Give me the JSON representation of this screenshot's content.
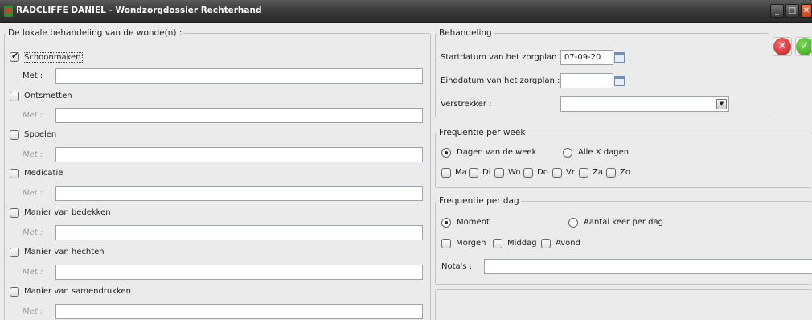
{
  "window": {
    "title": "RADCLIFFE DANIEL - Wondzorgdossier Rechterhand"
  },
  "left": {
    "legend": "De lokale behandeling van de wonde(n) :",
    "met_label": "Met :",
    "items": [
      {
        "label": "Schoonmaken",
        "checked": true,
        "met_value": ""
      },
      {
        "label": "Ontsmetten",
        "checked": false,
        "met_value": ""
      },
      {
        "label": "Spoelen",
        "checked": false,
        "met_value": ""
      },
      {
        "label": "Medicatie",
        "checked": false,
        "met_value": ""
      },
      {
        "label": "Manier van bedekken",
        "checked": false,
        "met_value": ""
      },
      {
        "label": "Manier van hechten",
        "checked": false,
        "met_value": ""
      },
      {
        "label": "Manier van samendrukken",
        "checked": false,
        "met_value": ""
      }
    ]
  },
  "behandeling": {
    "legend": "Behandeling",
    "start_label": "Startdatum van het zorgplan :",
    "start_value": "07-09-20",
    "end_label": "Einddatum van het zorgplan :",
    "end_value": "",
    "verstrekker_label": "Verstrekker :",
    "verstrekker_value": ""
  },
  "week": {
    "legend": "Frequentie per week",
    "option_days": "Dagen van de week",
    "option_x": "Alle X dagen",
    "selected": "days",
    "days": [
      "Ma",
      "Di",
      "Wo",
      "Do",
      "Vr",
      "Za",
      "Zo"
    ]
  },
  "dag": {
    "legend": "Frequentie per dag",
    "option_moment": "Moment",
    "option_count": "Aantal keer per dag",
    "selected": "moment",
    "moments": [
      "Morgen",
      "Middag",
      "Avond"
    ],
    "notes_label": "Nota's :",
    "notes_value": ""
  },
  "icons": {
    "cancel": "cancel-icon",
    "ok": "confirm-icon",
    "calendar": "calendar-icon"
  }
}
